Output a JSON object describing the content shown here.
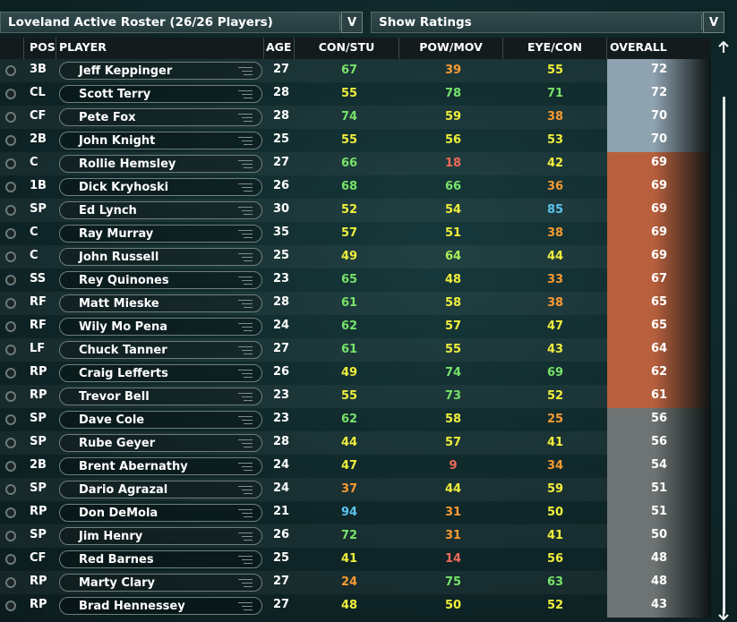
{
  "roster_dropdown": {
    "label": "Loveland Active Roster (26/26 Players)",
    "button": "V"
  },
  "view_dropdown": {
    "label": "Show Ratings",
    "button": "V"
  },
  "columns": {
    "pos": "POS",
    "player": "PLAYER",
    "age": "AGE",
    "con_stu": "CON/STU",
    "pow_mov": "POW/MOV",
    "eye_con": "EYE/CON",
    "overall": "OVERALL"
  },
  "colors": {
    "green": "#77e26a",
    "lightgreen": "#a9ef5a",
    "yellow": "#f0ee3c",
    "orange": "#f79a32",
    "red": "#ef6a5a",
    "blue": "#5cc4ef",
    "overall_silver": "#8fa2b0",
    "overall_copper": "#b8603d",
    "overall_gray": "#6e7474"
  },
  "players": [
    {
      "pos": "3B",
      "name": "Jeff Keppinger",
      "age": "27",
      "con": "67",
      "pow": "39",
      "eye": "55",
      "ovr": "72",
      "con_c": "green",
      "pow_c": "orange",
      "eye_c": "yellow",
      "tier": "silver"
    },
    {
      "pos": "CL",
      "name": "Scott Terry",
      "age": "28",
      "con": "55",
      "pow": "78",
      "eye": "71",
      "ovr": "72",
      "con_c": "yellow",
      "pow_c": "green",
      "eye_c": "green",
      "tier": "silver"
    },
    {
      "pos": "CF",
      "name": "Pete Fox",
      "age": "28",
      "con": "74",
      "pow": "59",
      "eye": "38",
      "ovr": "70",
      "con_c": "green",
      "pow_c": "yellow",
      "eye_c": "orange",
      "tier": "silver"
    },
    {
      "pos": "2B",
      "name": "John Knight",
      "age": "25",
      "con": "55",
      "pow": "56",
      "eye": "53",
      "ovr": "70",
      "con_c": "yellow",
      "pow_c": "yellow",
      "eye_c": "yellow",
      "tier": "silver"
    },
    {
      "pos": "C",
      "name": "Rollie Hemsley",
      "age": "27",
      "con": "66",
      "pow": "18",
      "eye": "42",
      "ovr": "69",
      "con_c": "green",
      "pow_c": "red",
      "eye_c": "yellow",
      "tier": "copper"
    },
    {
      "pos": "1B",
      "name": "Dick Kryhoski",
      "age": "26",
      "con": "68",
      "pow": "66",
      "eye": "36",
      "ovr": "69",
      "con_c": "green",
      "pow_c": "green",
      "eye_c": "orange",
      "tier": "copper"
    },
    {
      "pos": "SP",
      "name": "Ed Lynch",
      "age": "30",
      "con": "52",
      "pow": "54",
      "eye": "85",
      "ovr": "69",
      "con_c": "yellow",
      "pow_c": "yellow",
      "eye_c": "blue",
      "tier": "copper"
    },
    {
      "pos": "C",
      "name": "Ray Murray",
      "age": "35",
      "con": "57",
      "pow": "51",
      "eye": "38",
      "ovr": "69",
      "con_c": "yellow",
      "pow_c": "yellow",
      "eye_c": "orange",
      "tier": "copper"
    },
    {
      "pos": "C",
      "name": "John Russell",
      "age": "25",
      "con": "49",
      "pow": "64",
      "eye": "44",
      "ovr": "69",
      "con_c": "yellow",
      "pow_c": "lightgreen",
      "eye_c": "yellow",
      "tier": "copper"
    },
    {
      "pos": "SS",
      "name": "Rey Quinones",
      "age": "23",
      "con": "65",
      "pow": "48",
      "eye": "33",
      "ovr": "67",
      "con_c": "green",
      "pow_c": "yellow",
      "eye_c": "orange",
      "tier": "copper"
    },
    {
      "pos": "RF",
      "name": "Matt Mieske",
      "age": "28",
      "con": "61",
      "pow": "58",
      "eye": "38",
      "ovr": "65",
      "con_c": "green",
      "pow_c": "yellow",
      "eye_c": "orange",
      "tier": "copper"
    },
    {
      "pos": "RF",
      "name": "Wily Mo Pena",
      "age": "24",
      "con": "62",
      "pow": "57",
      "eye": "47",
      "ovr": "65",
      "con_c": "green",
      "pow_c": "yellow",
      "eye_c": "yellow",
      "tier": "copper"
    },
    {
      "pos": "LF",
      "name": "Chuck Tanner",
      "age": "27",
      "con": "61",
      "pow": "55",
      "eye": "43",
      "ovr": "64",
      "con_c": "green",
      "pow_c": "yellow",
      "eye_c": "yellow",
      "tier": "copper"
    },
    {
      "pos": "RP",
      "name": "Craig Lefferts",
      "age": "26",
      "con": "49",
      "pow": "74",
      "eye": "69",
      "ovr": "62",
      "con_c": "yellow",
      "pow_c": "green",
      "eye_c": "green",
      "tier": "copper"
    },
    {
      "pos": "RP",
      "name": "Trevor Bell",
      "age": "23",
      "con": "55",
      "pow": "73",
      "eye": "52",
      "ovr": "61",
      "con_c": "yellow",
      "pow_c": "green",
      "eye_c": "yellow",
      "tier": "copper"
    },
    {
      "pos": "SP",
      "name": "Dave Cole",
      "age": "23",
      "con": "62",
      "pow": "58",
      "eye": "25",
      "ovr": "56",
      "con_c": "green",
      "pow_c": "yellow",
      "eye_c": "orange",
      "tier": "gray"
    },
    {
      "pos": "SP",
      "name": "Rube Geyer",
      "age": "28",
      "con": "44",
      "pow": "57",
      "eye": "41",
      "ovr": "56",
      "con_c": "yellow",
      "pow_c": "yellow",
      "eye_c": "yellow",
      "tier": "gray"
    },
    {
      "pos": "2B",
      "name": "Brent Abernathy",
      "age": "24",
      "con": "47",
      "pow": "9",
      "eye": "34",
      "ovr": "54",
      "con_c": "yellow",
      "pow_c": "red",
      "eye_c": "orange",
      "tier": "gray"
    },
    {
      "pos": "SP",
      "name": "Dario Agrazal",
      "age": "24",
      "con": "37",
      "pow": "44",
      "eye": "59",
      "ovr": "51",
      "con_c": "orange",
      "pow_c": "yellow",
      "eye_c": "yellow",
      "tier": "gray"
    },
    {
      "pos": "RP",
      "name": "Don DeMola",
      "age": "21",
      "con": "94",
      "pow": "31",
      "eye": "50",
      "ovr": "51",
      "con_c": "blue",
      "pow_c": "orange",
      "eye_c": "yellow",
      "tier": "gray"
    },
    {
      "pos": "SP",
      "name": "Jim Henry",
      "age": "26",
      "con": "72",
      "pow": "31",
      "eye": "41",
      "ovr": "50",
      "con_c": "green",
      "pow_c": "orange",
      "eye_c": "yellow",
      "tier": "gray"
    },
    {
      "pos": "CF",
      "name": "Red Barnes",
      "age": "25",
      "con": "41",
      "pow": "14",
      "eye": "56",
      "ovr": "48",
      "con_c": "yellow",
      "pow_c": "red",
      "eye_c": "yellow",
      "tier": "gray"
    },
    {
      "pos": "RP",
      "name": "Marty Clary",
      "age": "27",
      "con": "24",
      "pow": "75",
      "eye": "63",
      "ovr": "48",
      "con_c": "orange",
      "pow_c": "green",
      "eye_c": "green",
      "tier": "gray"
    },
    {
      "pos": "RP",
      "name": "Brad Hennessey",
      "age": "27",
      "con": "48",
      "pow": "50",
      "eye": "52",
      "ovr": "43",
      "con_c": "yellow",
      "pow_c": "yellow",
      "eye_c": "yellow",
      "tier": "gray"
    }
  ]
}
